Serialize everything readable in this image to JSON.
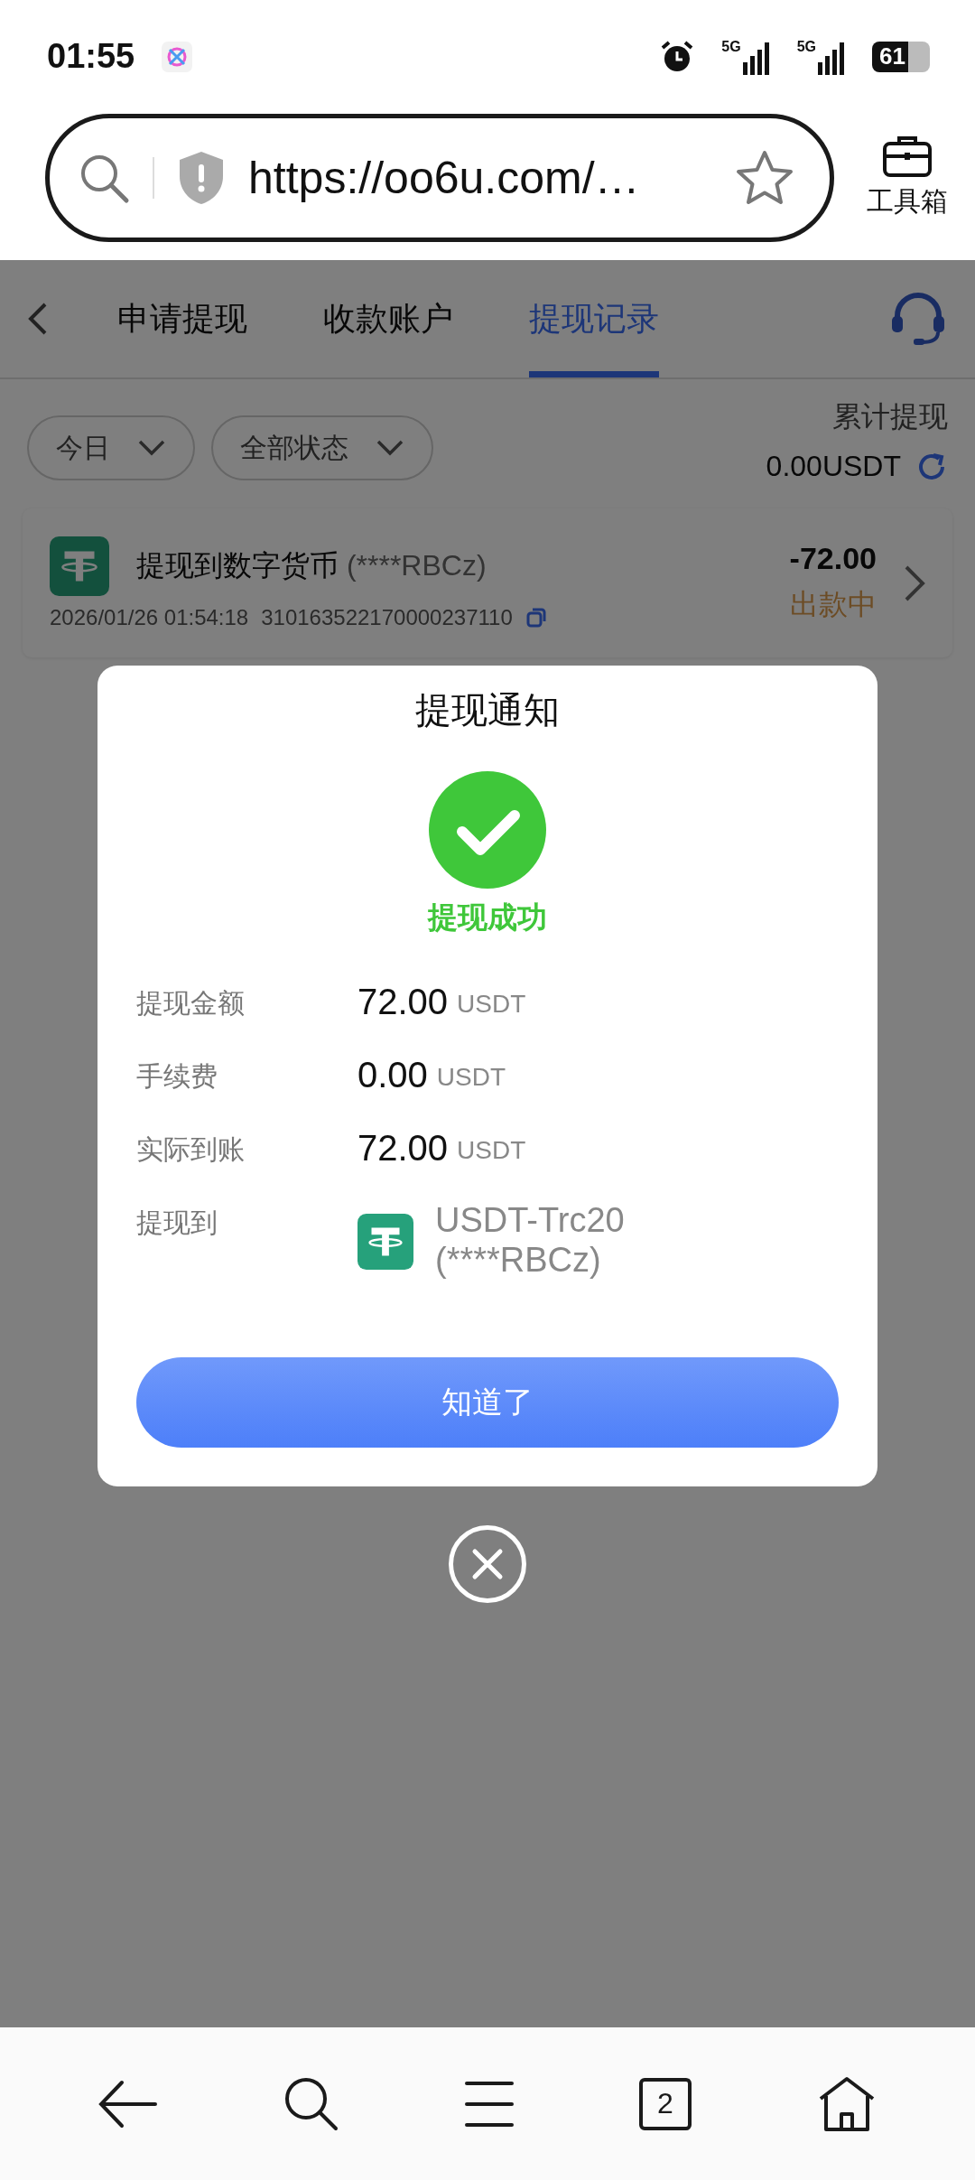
{
  "status_bar": {
    "time": "01:55",
    "signals": [
      "5G",
      "5G"
    ],
    "battery": "61"
  },
  "browser": {
    "url": "https://oo6u.com/…",
    "toolbox_label": "工具箱"
  },
  "tabs": [
    {
      "label": "申请提现",
      "selected": false
    },
    {
      "label": "收款账户",
      "selected": false
    },
    {
      "label": "提现记录",
      "selected": true
    }
  ],
  "filters": [
    {
      "label": "今日"
    },
    {
      "label": "全部状态"
    }
  ],
  "total": {
    "label": "累计提现",
    "value": "0.00USDT"
  },
  "records": [
    {
      "title": "提现到数字货币",
      "account": "(****RBCz)",
      "time": "2026/01/26 01:54:18",
      "order": "310163522170000237110",
      "amount": "-72.00",
      "status": "出款中"
    }
  ],
  "dialog": {
    "title": "提现通知",
    "result": "提现成功",
    "rows": [
      {
        "label": "提现金额",
        "value": "72.00",
        "unit": "USDT"
      },
      {
        "label": "手续费",
        "value": "0.00",
        "unit": "USDT"
      },
      {
        "label": "实际到账",
        "value": "72.00",
        "unit": "USDT"
      }
    ],
    "destination": {
      "label": "提现到",
      "name": "USDT-Trc20",
      "account": "(****RBCz)"
    },
    "button": "知道了"
  },
  "bottom_nav": {
    "tab_count": "2"
  }
}
